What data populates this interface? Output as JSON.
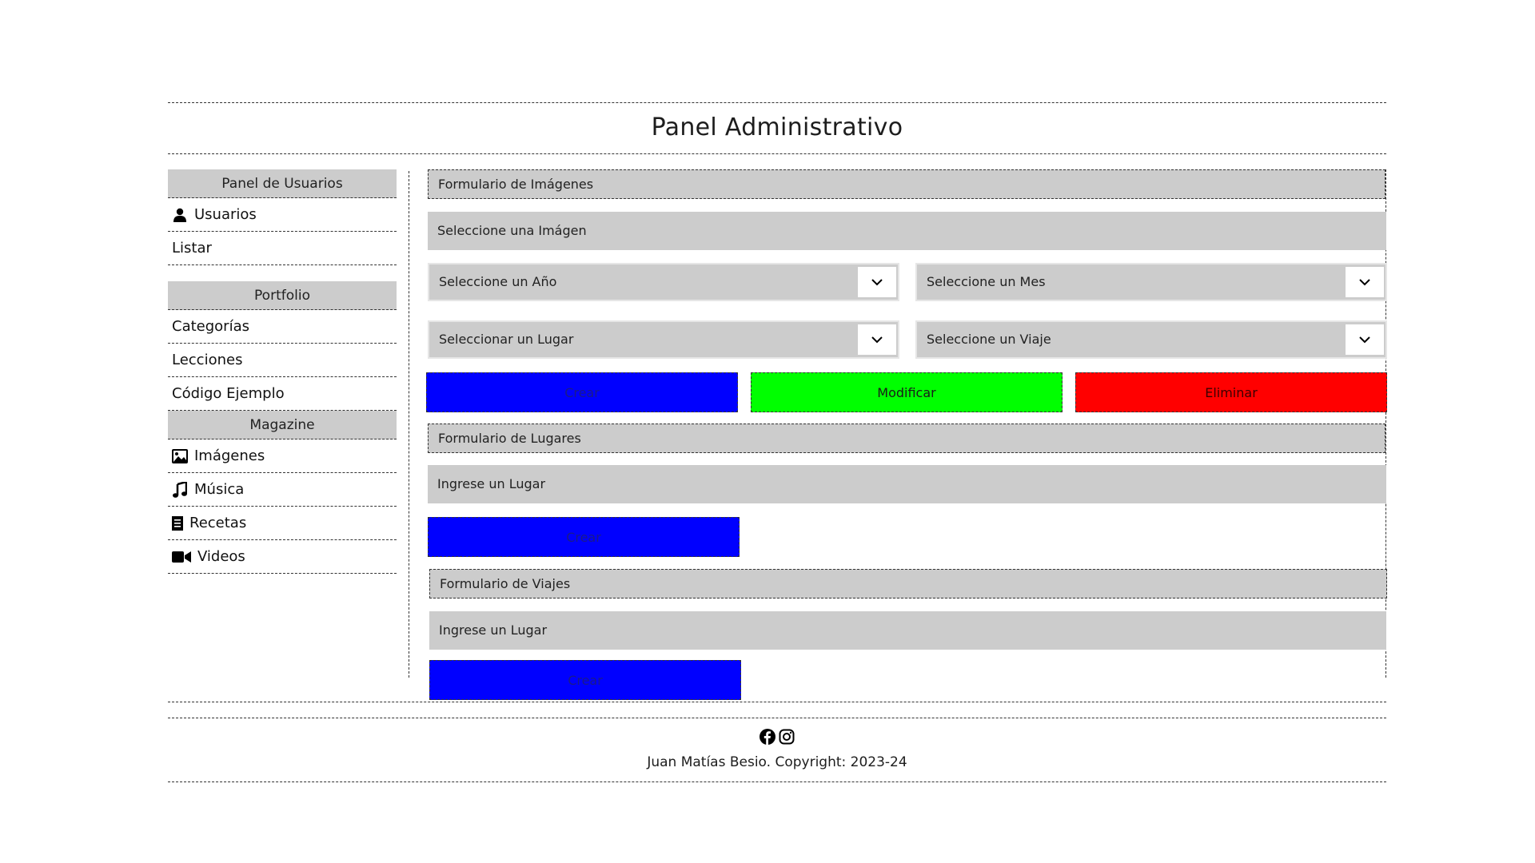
{
  "header": {
    "title": "Panel Administrativo"
  },
  "sidebar": {
    "sections": [
      {
        "heading": "Panel de Usuarios",
        "items": [
          {
            "label": "Usuarios",
            "icon": "user-icon"
          },
          {
            "label": "Listar",
            "icon": ""
          }
        ]
      },
      {
        "heading": "Portfolio",
        "items": [
          {
            "label": "Categorías"
          },
          {
            "label": "Lecciones"
          },
          {
            "label": "Código Ejemplo"
          }
        ]
      },
      {
        "heading": "Magazine",
        "items": [
          {
            "label": "Imágenes",
            "icon": "image-icon"
          },
          {
            "label": "Música",
            "icon": "music-icon"
          },
          {
            "label": "Recetas",
            "icon": "receipt-icon"
          },
          {
            "label": "Videos",
            "icon": "video-icon"
          }
        ]
      }
    ]
  },
  "forms": {
    "imagenes": {
      "heading": "Formulario de Imágenes",
      "file_placeholder": "Seleccione una Imágen",
      "year_select": "Seleccione un Año",
      "month_select": "Seleccione un Mes",
      "place_select": "Seleccionar un Lugar",
      "trip_select": "Seleccione un Viaje",
      "create_label": "Crear",
      "modify_label": "Modificar",
      "delete_label": "Eliminar"
    },
    "lugares": {
      "heading": "Formulario de Lugares",
      "input_placeholder": "Ingrese un Lugar",
      "create_label": "Crear"
    },
    "viajes": {
      "heading": "Formulario de Viajes",
      "input_placeholder": "Ingrese un Lugar",
      "create_label": "Crear"
    }
  },
  "footer": {
    "social": [
      "facebook-icon",
      "instagram-icon"
    ],
    "copyright": "Juan Matías Besio. Copyright: 2023-24"
  },
  "colors": {
    "create": "#0000ff",
    "modify": "#00ff00",
    "delete": "#ff0000",
    "panel": "#cccccc"
  }
}
